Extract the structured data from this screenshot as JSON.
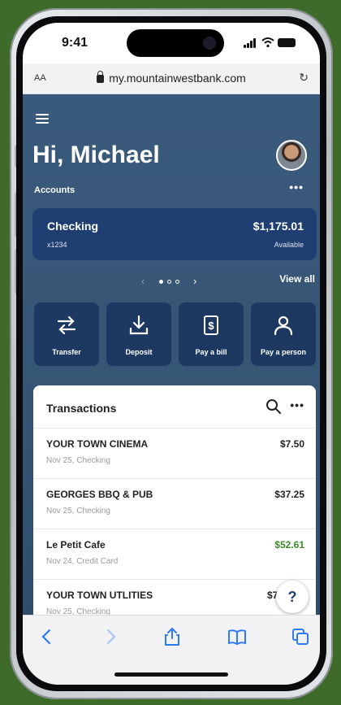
{
  "status_bar": {
    "time": "9:41"
  },
  "browser": {
    "text_size_label": "AA",
    "url": "my.mountainwestbank.com"
  },
  "header": {
    "greeting": "Hi, Michael",
    "accounts_label": "Accounts",
    "accounts_more": "•••"
  },
  "account_card": {
    "name": "Checking",
    "number": "x1234",
    "balance": "$1,175.01",
    "balance_label": "Available"
  },
  "carousel": {
    "view_all": "View all"
  },
  "actions": [
    {
      "label": "Transfer",
      "icon": "transfer-icon"
    },
    {
      "label": "Deposit",
      "icon": "deposit-icon"
    },
    {
      "label": "Pay a bill",
      "icon": "bill-icon"
    },
    {
      "label": "Pay a person",
      "icon": "person-icon"
    }
  ],
  "transactions": {
    "title": "Transactions",
    "more": "•••",
    "rows": [
      {
        "merchant": "YOUR TOWN CINEMA",
        "detail": "Nov 25, Checking",
        "amount": "$7.50",
        "credit": false
      },
      {
        "merchant": "GEORGES BBQ & PUB",
        "detail": "Nov 25, Checking",
        "amount": "$37.25",
        "credit": false
      },
      {
        "merchant": "Le Petit Cafe",
        "detail": "Nov 24, Credit Card",
        "amount": "$52.61",
        "credit": true
      },
      {
        "merchant": "YOUR TOWN UTLITIES",
        "detail": "Nov 25, Checking",
        "amount": "$76",
        "credit": false
      }
    ]
  },
  "help_label": "?",
  "colors": {
    "brand_navy": "#1f3f72",
    "header_bg": "#3a5a7c",
    "credit_green": "#3a8a2a",
    "background_green": "#3f6b2a"
  }
}
